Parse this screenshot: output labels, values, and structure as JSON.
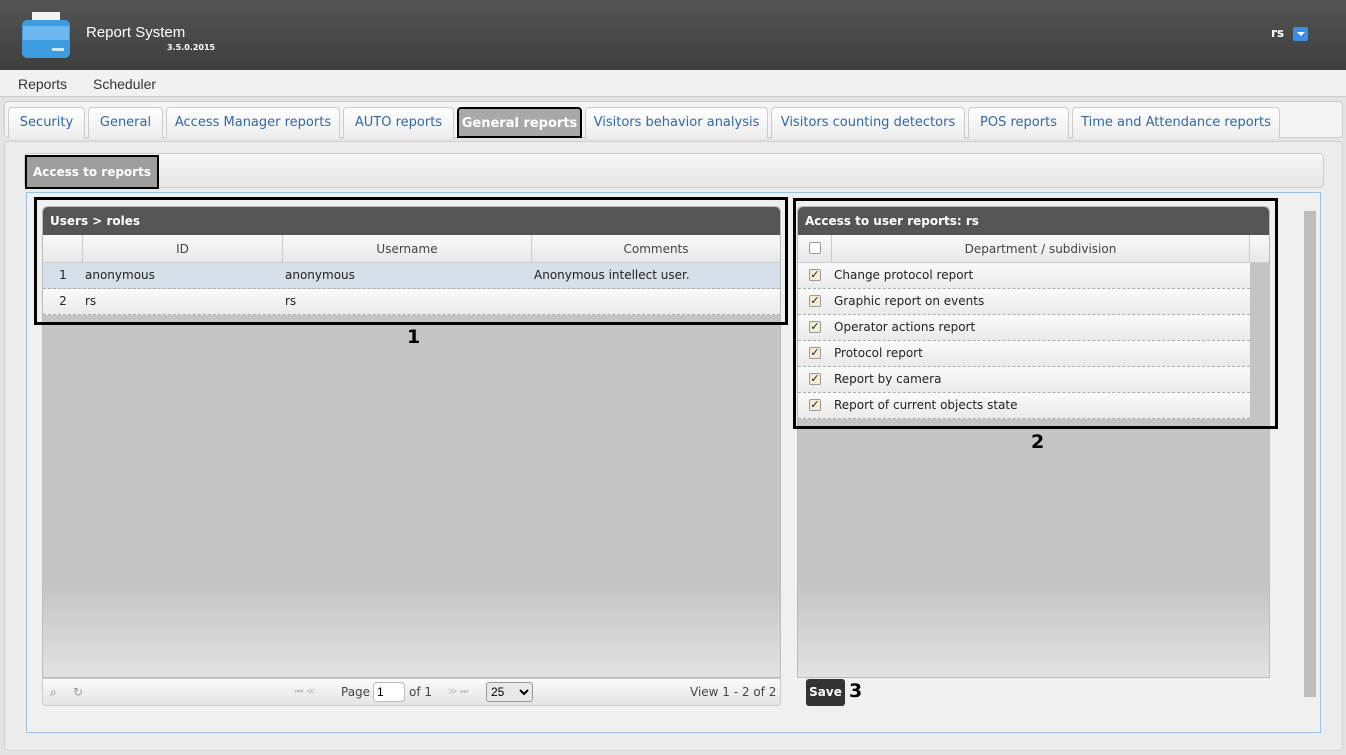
{
  "app": {
    "title": "Report System",
    "version": "3.5.0.2015",
    "user": "rs"
  },
  "menu": [
    "Reports",
    "Scheduler"
  ],
  "tabs": [
    "Security",
    "General",
    "Access Manager reports",
    "AUTO reports",
    "General reports",
    "Visitors behavior analysis",
    "Visitors counting detectors",
    "POS reports",
    "Time and Attendance reports"
  ],
  "inner_tab": "Access to reports",
  "users_grid": {
    "title": "Users > roles",
    "columns": [
      "ID",
      "Username",
      "Comments"
    ],
    "rows": [
      {
        "n": "1",
        "id": "anonymous",
        "username": "anonymous",
        "comments": "Anonymous intellect user."
      },
      {
        "n": "2",
        "id": "rs",
        "username": "rs",
        "comments": ""
      }
    ]
  },
  "pager": {
    "page_label": "Page",
    "page": "1",
    "of": "of 1",
    "per_page": "25",
    "view": "View 1 - 2 of 2"
  },
  "reports_grid": {
    "title": "Access to user reports: rs",
    "column": "Department / subdivision",
    "rows": [
      "Change protocol report",
      "Graphic report on events",
      "Operator actions report",
      "Protocol report",
      "Report by camera",
      "Report of current objects state"
    ],
    "check": "✓"
  },
  "save_label": "Save",
  "annotations": [
    "1",
    "2",
    "3"
  ]
}
